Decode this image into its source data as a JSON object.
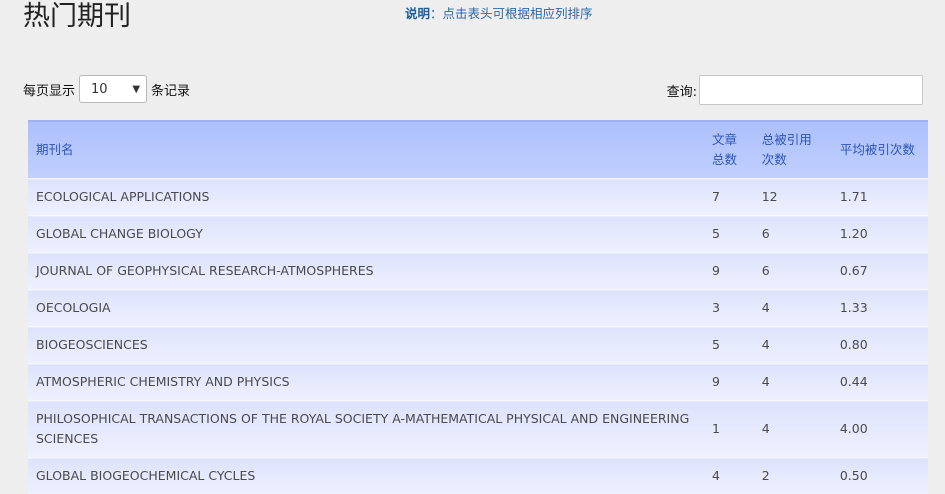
{
  "page": {
    "title": "热门期刊",
    "note_label": "说明",
    "note_text": "：点击表头可根据相应列排序"
  },
  "length": {
    "prefix": "每页显示",
    "selected": "10",
    "suffix": "条记录"
  },
  "search": {
    "label": "查询:",
    "value": "",
    "placeholder": ""
  },
  "table": {
    "headers": [
      "期刊名",
      "文章总数",
      "总被引用次数",
      "平均被引次数"
    ],
    "rows": [
      [
        "ECOLOGICAL APPLICATIONS",
        "7",
        "12",
        "1.71"
      ],
      [
        "GLOBAL CHANGE BIOLOGY",
        "5",
        "6",
        "1.20"
      ],
      [
        "JOURNAL OF GEOPHYSICAL RESEARCH-ATMOSPHERES",
        "9",
        "6",
        "0.67"
      ],
      [
        "OECOLOGIA",
        "3",
        "4",
        "1.33"
      ],
      [
        "BIOGEOSCIENCES",
        "5",
        "4",
        "0.80"
      ],
      [
        "ATMOSPHERIC CHEMISTRY AND PHYSICS",
        "9",
        "4",
        "0.44"
      ],
      [
        "PHILOSOPHICAL TRANSACTIONS OF THE ROYAL SOCIETY A-MATHEMATICAL PHYSICAL AND ENGINEERING SCIENCES",
        "1",
        "4",
        "4.00"
      ],
      [
        "GLOBAL BIOGEOCHEMICAL CYCLES",
        "4",
        "2",
        "0.50"
      ]
    ]
  },
  "colors": {
    "header_text": "#2b55b8",
    "note_text": "#2a6aa8"
  }
}
